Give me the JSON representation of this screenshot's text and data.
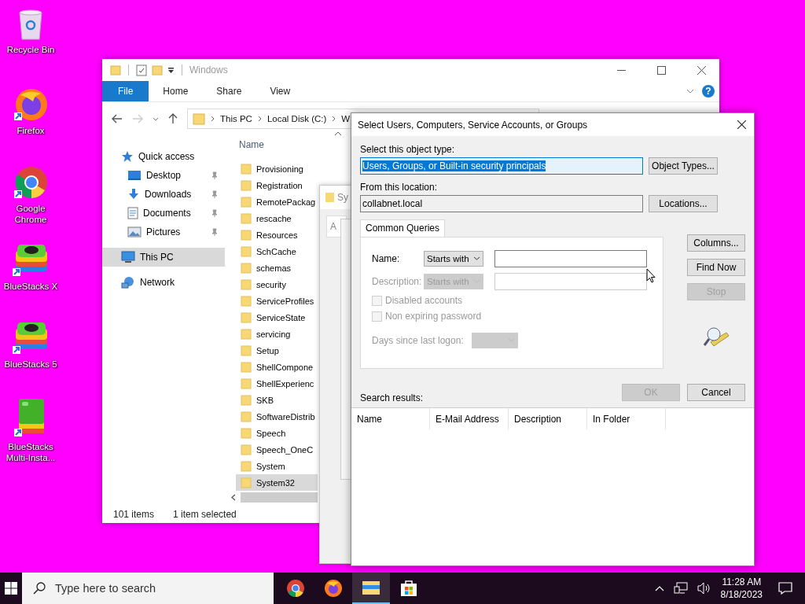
{
  "desktop_icons": [
    {
      "label": "Recycle Bin",
      "kind": "recycle"
    },
    {
      "label": "Firefox",
      "kind": "firefox"
    },
    {
      "label": "Google Chrome",
      "kind": "chrome"
    },
    {
      "label": "BlueStacks X",
      "kind": "bluestacks"
    },
    {
      "label": "BlueStacks 5",
      "kind": "bluestacks"
    },
    {
      "label": "BlueStacks Multi-Insta...",
      "kind": "bluestacks_multi"
    }
  ],
  "explorer": {
    "title": "Windows",
    "ribbon_tabs": [
      {
        "label": "File",
        "selected": true
      },
      {
        "label": "Home",
        "selected": false
      },
      {
        "label": "Share",
        "selected": false
      },
      {
        "label": "View",
        "selected": false
      }
    ],
    "help": "?",
    "breadcrumb": [
      "This PC",
      "Local Disk (C:)",
      "W"
    ],
    "nav": [
      {
        "label": "Quick access",
        "kind": "star",
        "selected": false,
        "children": [
          {
            "label": "Desktop",
            "kind": "desktop",
            "pinned": true,
            "selected": false
          },
          {
            "label": "Downloads",
            "kind": "downloads",
            "pinned": true,
            "selected": false
          },
          {
            "label": "Documents",
            "kind": "documents",
            "pinned": true,
            "selected": false
          },
          {
            "label": "Pictures",
            "kind": "pictures",
            "pinned": true,
            "selected": false
          }
        ]
      },
      {
        "label": "This PC",
        "kind": "pc",
        "selected": true
      },
      {
        "label": "Network",
        "kind": "network",
        "selected": false
      }
    ],
    "column_header": "Name",
    "files": [
      {
        "name": "Provisioning",
        "selected": false
      },
      {
        "name": "Registration",
        "selected": false
      },
      {
        "name": "RemotePackag",
        "selected": false
      },
      {
        "name": "rescache",
        "selected": false
      },
      {
        "name": "Resources",
        "selected": false
      },
      {
        "name": "SchCache",
        "selected": false
      },
      {
        "name": "schemas",
        "selected": false
      },
      {
        "name": "security",
        "selected": false
      },
      {
        "name": "ServiceProfiles",
        "selected": false
      },
      {
        "name": "ServiceState",
        "selected": false
      },
      {
        "name": "servicing",
        "selected": false
      },
      {
        "name": "Setup",
        "selected": false
      },
      {
        "name": "ShellCompone",
        "selected": false
      },
      {
        "name": "ShellExperienc",
        "selected": false
      },
      {
        "name": "SKB",
        "selected": false
      },
      {
        "name": "SoftwareDistrib",
        "selected": false
      },
      {
        "name": "Speech",
        "selected": false
      },
      {
        "name": "Speech_OneC",
        "selected": false
      },
      {
        "name": "System",
        "selected": false
      },
      {
        "name": "System32",
        "selected": true
      }
    ],
    "status": [
      "101 items",
      "1 item selected"
    ]
  },
  "background_window": {
    "title": "Sy",
    "tab": "A"
  },
  "dialog": {
    "title": "Select Users, Computers, Service Accounts, or Groups",
    "object_type_label": "Select this object type:",
    "object_type_value": "Users, Groups, or Built-in security principals",
    "object_type_highlighted": true,
    "object_types_button": "Object Types...",
    "location_label": "From this location:",
    "location_value": "collabnet.local",
    "locations_button": "Locations...",
    "tab": "Common Queries",
    "queries": [
      {
        "label": "Name:",
        "match": "Starts with",
        "disabled": false
      },
      {
        "label": "Description:",
        "match": "Starts with",
        "disabled": true
      }
    ],
    "checkboxes": [
      {
        "label": "Disabled accounts",
        "checked": false,
        "disabled": true
      },
      {
        "label": "Non expiring password",
        "checked": false,
        "disabled": true
      }
    ],
    "days_label": "Days since last logon:",
    "side_buttons": [
      {
        "label": "Columns...",
        "disabled": false
      },
      {
        "label": "Find Now",
        "disabled": false
      },
      {
        "label": "Stop",
        "disabled": true
      }
    ],
    "ok": {
      "label": "OK",
      "disabled": true
    },
    "cancel": {
      "label": "Cancel",
      "disabled": false
    },
    "results_label": "Search results:",
    "result_columns": [
      "Name",
      "E-Mail Address",
      "Description",
      "In Folder"
    ]
  },
  "taskbar": {
    "search_placeholder": "Type here to search",
    "apps": [
      {
        "kind": "chrome",
        "active": false
      },
      {
        "kind": "firefox",
        "active": false
      },
      {
        "kind": "explorer",
        "active": true
      },
      {
        "kind": "store",
        "active": false
      }
    ],
    "time": "11:28 AM",
    "date": "8/18/2023"
  }
}
